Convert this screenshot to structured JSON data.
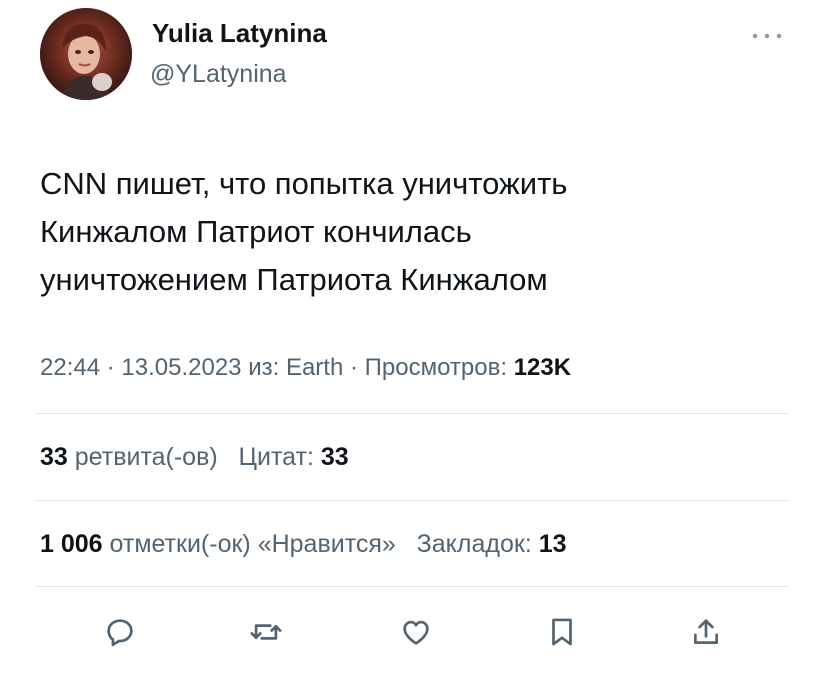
{
  "author": {
    "display_name": "Yulia Latynina",
    "handle": "@YLatynina"
  },
  "tweet": {
    "lines": [
      "CNN пишет, что попытка уничтожить",
      "Кинжалом Патриот кончилась",
      "уничтожением Патриота Кинжалом"
    ],
    "time": "22:44",
    "date": "13.05.2023",
    "source_prefix": "из: ",
    "source": "Earth",
    "views_label": "Просмотров:",
    "views": "123K"
  },
  "stats": {
    "retweets": "33",
    "retweets_label": "ретвита(-ов)",
    "quotes_label": "Цитат:",
    "quotes": "33",
    "likes": "1 006",
    "likes_label": "отметки(-ок) «Нравится»",
    "bookmarks_label": "Закладок:",
    "bookmarks": "13"
  },
  "actions": {
    "icons": [
      "reply-icon",
      "retweet-icon",
      "like-icon",
      "bookmark-icon",
      "share-icon"
    ],
    "icon_color": "#536471"
  },
  "colors": {
    "text": "#0f1419",
    "secondary": "#536471",
    "divider": "#e4e7ea"
  }
}
